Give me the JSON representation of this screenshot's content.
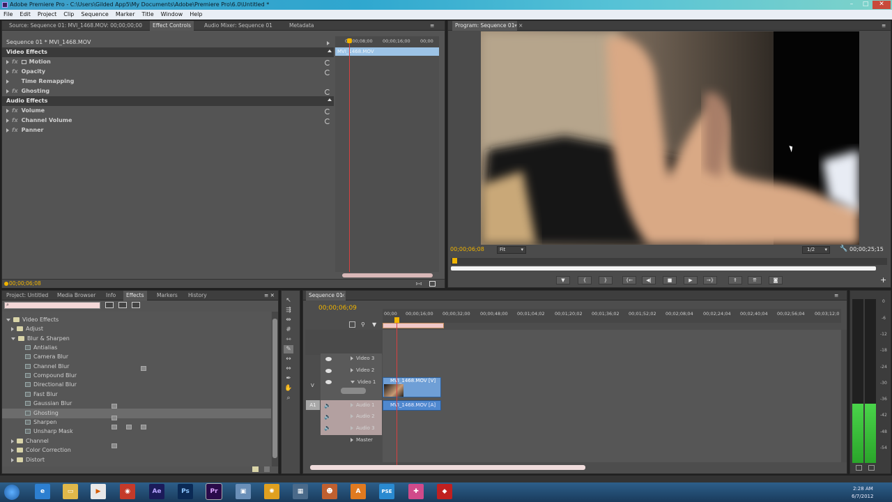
{
  "titlebar": {
    "title": "Adobe Premiere Pro - C:\\Users\\Gilded App5\\My Documents\\Adobe\\Premiere Pro\\6.0\\Untitled *"
  },
  "menu": [
    "File",
    "Edit",
    "Project",
    "Clip",
    "Sequence",
    "Marker",
    "Title",
    "Window",
    "Help"
  ],
  "source_tabs": [
    "Source: Sequence 01: MVI_1468.MOV: 00;00;00;00",
    "Effect Controls",
    "Audio Mixer: Sequence 01",
    "Metadata"
  ],
  "effect_controls": {
    "clip": "Sequence 01 * MVI_1468.MOV",
    "ruler": [
      "00;00;08;00",
      "00;00;16;00",
      "00;00"
    ],
    "clip_bar": "MVI_1468.MOV",
    "video_header": "Video Effects",
    "video_items": [
      "Motion",
      "Opacity",
      "Time Remapping",
      "Ghosting"
    ],
    "audio_header": "Audio Effects",
    "audio_items": [
      "Volume",
      "Channel Volume",
      "Panner"
    ],
    "timecode": "00;00;06;08"
  },
  "program": {
    "tab": "Program: Sequence 01",
    "timecode": "00;00;06;08",
    "fit": "Fit",
    "res": "1/2",
    "duration": "00;00;25;15"
  },
  "project_tabs": [
    "Project: Untitled",
    "Media Browser",
    "Info",
    "Effects",
    "Markers",
    "History"
  ],
  "effects_tree": {
    "root": "Video Effects",
    "folders_top": [
      "Adjust",
      "Blur & Sharpen"
    ],
    "blur_items": [
      "Antialias",
      "Camera Blur",
      "Channel Blur",
      "Compound Blur",
      "Directional Blur",
      "Fast Blur",
      "Gaussian Blur",
      "Ghosting",
      "Sharpen",
      "Unsharp Mask"
    ],
    "folders_bottom": [
      "Channel",
      "Color Correction",
      "Distort"
    ]
  },
  "sequence": {
    "tab": "Sequence 01",
    "timecode": "00;00;06;09",
    "ruler": [
      "00;00",
      "00;00;16;00",
      "00;00;32;00",
      "00;00;48;00",
      "00;01;04;02",
      "00;01;20;02",
      "00;01;36;02",
      "00;01;52;02",
      "00;02;08;04",
      "00;02;24;04",
      "00;02;40;04",
      "00;02;56;04",
      "00;03;12;0"
    ],
    "tracks": [
      "Video 3",
      "Video 2",
      "Video 1",
      "Audio 1",
      "Audio 2",
      "Audio 3",
      "Master"
    ],
    "v_label": "V",
    "a_label": "A1",
    "video_clip": "MVI_1468.MOV [V]",
    "audio_clip": "MVI_1468.MOV [A]"
  },
  "meter_scale": [
    "0",
    "-6",
    "-12",
    "-18",
    "-24",
    "-30",
    "-36",
    "-42",
    "-48",
    "-54"
  ],
  "taskbar": {
    "time": "2:28 AM",
    "date": "6/7/2012",
    "icons": [
      "Ae",
      "Ps",
      "Pr",
      "PSE"
    ]
  },
  "colors": {
    "accent": "#f0b400",
    "clip_video": "#4a8ad0",
    "clip_audio": "#3a78c8",
    "playhead": "#d84040",
    "panel": "#545454"
  }
}
